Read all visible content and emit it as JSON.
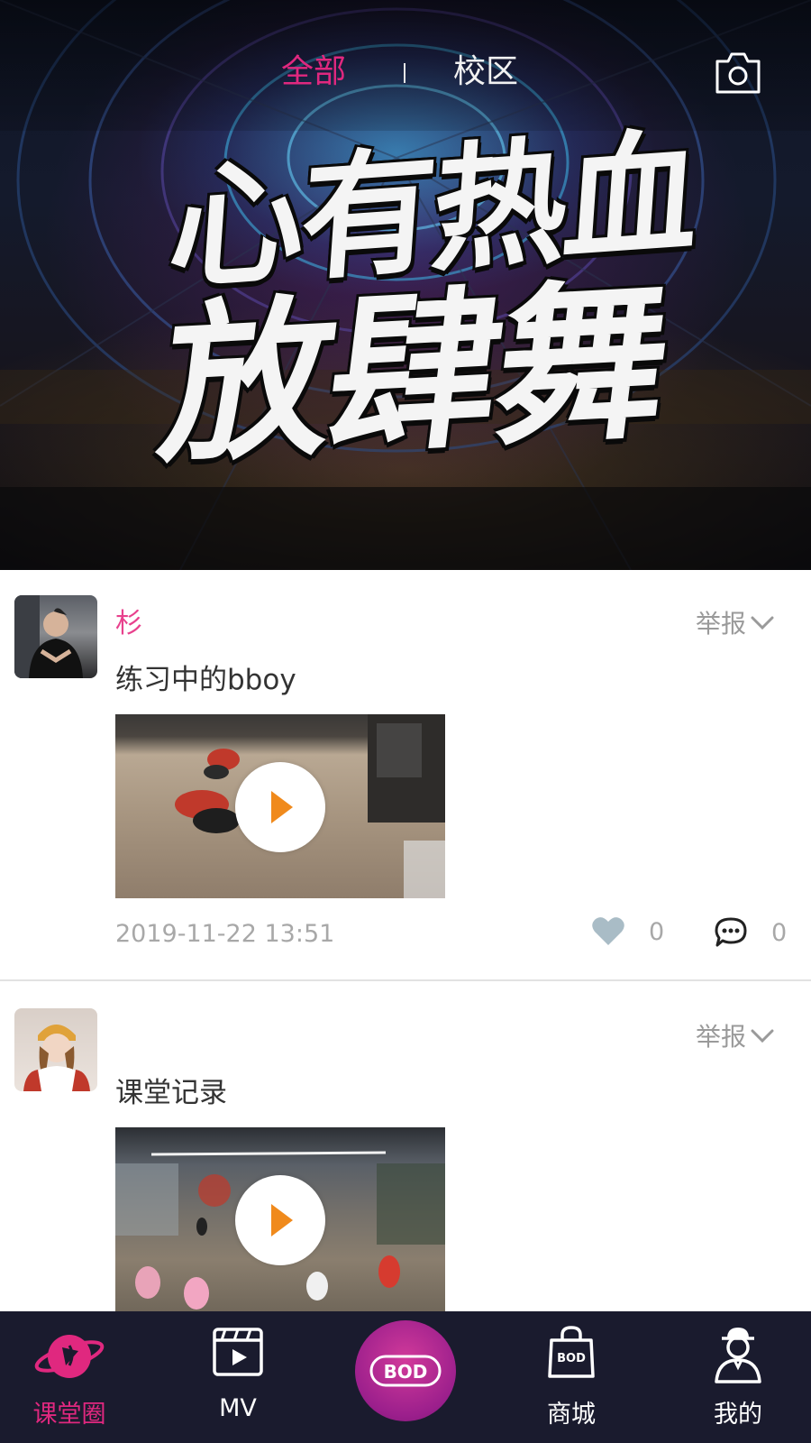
{
  "header": {
    "tabs": [
      {
        "label": "全部",
        "active": true
      },
      {
        "label": "校区",
        "active": false
      }
    ],
    "camera_icon": "camera-icon",
    "banner": {
      "slogan_line1": "心有热血",
      "slogan_line2": "放肆舞"
    }
  },
  "feed": {
    "posts": [
      {
        "username": "杉",
        "report_label": "举报",
        "text": "练习中的bboy",
        "timestamp": "2019-11-22 13:51",
        "likes": "0",
        "comments": "0"
      },
      {
        "username": "",
        "report_label": "举报",
        "text": "课堂记录"
      }
    ]
  },
  "bottom_nav": {
    "items": [
      {
        "label": "课堂圈",
        "icon": "planet-icon",
        "active": true
      },
      {
        "label": "MV",
        "icon": "clapperboard-icon",
        "active": false
      },
      {
        "label": "",
        "icon": "brand-logo",
        "active": false
      },
      {
        "label": "商城",
        "icon": "shopping-bag-icon",
        "active": false
      },
      {
        "label": "我的",
        "icon": "user-hat-icon",
        "active": false
      }
    ],
    "center_logo_text": "BOD"
  },
  "colors": {
    "accent": "#e0287f",
    "nav_bg": "#1a1b2e",
    "play_triangle": "#f08a1c",
    "like_heart": "#a9bcc6"
  }
}
